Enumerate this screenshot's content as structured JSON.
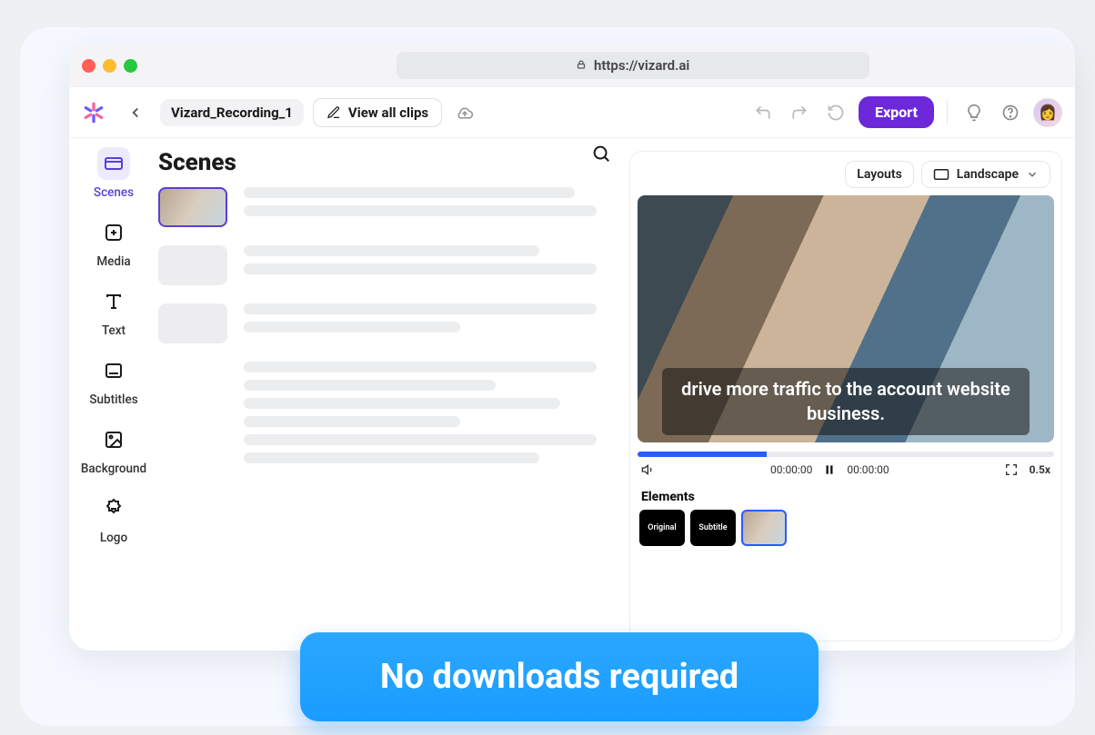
{
  "url": "https://vizard.ai",
  "toolbar": {
    "project_name": "Vizard_Recording_1",
    "view_all": "View all clips",
    "export": "Export"
  },
  "sidebar": {
    "items": [
      {
        "label": "Scenes"
      },
      {
        "label": "Media"
      },
      {
        "label": "Text"
      },
      {
        "label": "Subtitles"
      },
      {
        "label": "Background"
      },
      {
        "label": "Logo"
      }
    ]
  },
  "center": {
    "heading": "Scenes"
  },
  "right": {
    "layouts_btn": "Layouts",
    "orientation": "Landscape",
    "caption": "drive more traffic to the account website business.",
    "time_left": "00:00:00",
    "time_right": "00:00:00",
    "speed": "0.5x",
    "elements_label": "Elements",
    "elements": [
      "Original",
      "Subtitle",
      ""
    ]
  },
  "banner": "No downloads required"
}
